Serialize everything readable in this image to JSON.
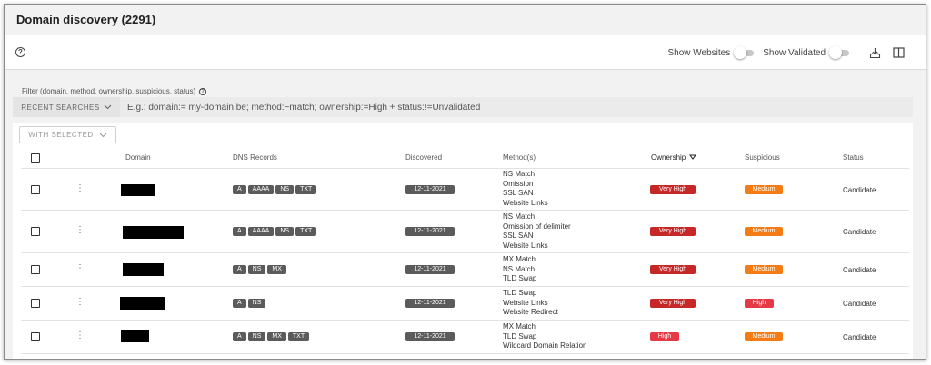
{
  "header": {
    "title": "Domain discovery (2291)"
  },
  "toolbar": {
    "show_websites_label": "Show Websites",
    "show_validated_label": "Show Validated",
    "help_icon": "?"
  },
  "filter": {
    "label": "Filter (domain, method, ownership, suspicious, status)",
    "recent_searches": "RECENT SEARCHES",
    "placeholder": "E.g.: domain:= my-domain.be; method:~match; ownership:=High + status:!=Unvalidated"
  },
  "table": {
    "with_selected": "WITH SELECTED",
    "columns": {
      "domain": "Domain",
      "dns": "DNS Records",
      "discovered": "Discovered",
      "methods": "Method(s)",
      "ownership": "Ownership",
      "suspicious": "Suspicious",
      "status": "Status"
    },
    "rows": [
      {
        "dns": [
          "A",
          "AAAA",
          "NS",
          "TXT"
        ],
        "discovered": "12-11-2021",
        "methods": [
          "NS Match",
          "Omission",
          "SSL SAN",
          "Website Links"
        ],
        "ownership": "Very High",
        "suspicious": "Medium",
        "status": "Candidate"
      },
      {
        "dns": [
          "A",
          "AAAA",
          "NS",
          "TXT"
        ],
        "discovered": "12-11-2021",
        "methods": [
          "NS Match",
          "Omission of delimiter",
          "SSL SAN",
          "Website Links"
        ],
        "ownership": "Very High",
        "suspicious": "Medium",
        "status": "Candidate"
      },
      {
        "dns": [
          "A",
          "NS",
          "MX"
        ],
        "discovered": "12-11-2021",
        "methods": [
          "MX Match",
          "NS Match",
          "TLD Swap"
        ],
        "ownership": "Very High",
        "suspicious": "Medium",
        "status": "Candidate"
      },
      {
        "dns": [
          "A",
          "NS"
        ],
        "discovered": "12-11-2021",
        "methods": [
          "TLD Swap",
          "Website Links",
          "Website Redirect"
        ],
        "ownership": "Very High",
        "suspicious": "High",
        "status": "Candidate"
      },
      {
        "dns": [
          "A",
          "NS",
          "MX",
          "TXT"
        ],
        "discovered": "12-11-2021",
        "methods": [
          "MX Match",
          "TLD Swap",
          "Wildcard Domain Relation"
        ],
        "ownership": "High",
        "suspicious": "Medium",
        "status": "Candidate"
      }
    ]
  },
  "colors": {
    "very_high": "#c62828",
    "high_ownership": "#e53945",
    "medium": "#f57c14",
    "high_suspicious": "#e53945",
    "badge_gray": "#5b5b5b"
  },
  "icons": {
    "sort": "sort-down-icon",
    "download": "download-icon",
    "columns": "columns-icon",
    "kebab": "more-vertical-icon"
  }
}
